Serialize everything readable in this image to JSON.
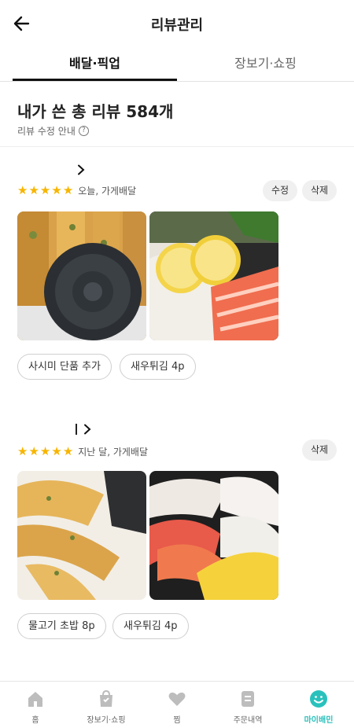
{
  "header": {
    "title": "리뷰관리",
    "back_icon": "arrow-left-icon"
  },
  "tabs": [
    {
      "label": "배달·픽업",
      "active": true
    },
    {
      "label": "장보기·쇼핑",
      "active": false
    }
  ],
  "summary": {
    "title": "내가 쓴 총 리뷰 584개",
    "sub": "리뷰 수정 안내",
    "help_icon": "?"
  },
  "reviews": [
    {
      "stars": 5,
      "meta": "오늘, 가게배달",
      "buttons": [
        "수정",
        "삭제"
      ],
      "menus": [
        "사시미 단품 추가",
        "새우튀김 4p"
      ]
    },
    {
      "stars": 5,
      "meta": "지난 달, 가게배달",
      "buttons": [
        "삭제"
      ],
      "menus": [
        "물고기 초밥 8p",
        "새우튀김 4p"
      ]
    }
  ],
  "nav": [
    {
      "label": "홈",
      "icon": "home-icon",
      "active": false
    },
    {
      "label": "장보기·쇼핑",
      "icon": "shopping-bag-icon",
      "active": false
    },
    {
      "label": "찜",
      "icon": "heart-icon",
      "active": false
    },
    {
      "label": "주문내역",
      "icon": "receipt-icon",
      "active": false
    },
    {
      "label": "마이배민",
      "icon": "smile-icon",
      "active": true
    }
  ],
  "colors": {
    "accent": "#2ac1bc",
    "star": "#f7b500"
  }
}
